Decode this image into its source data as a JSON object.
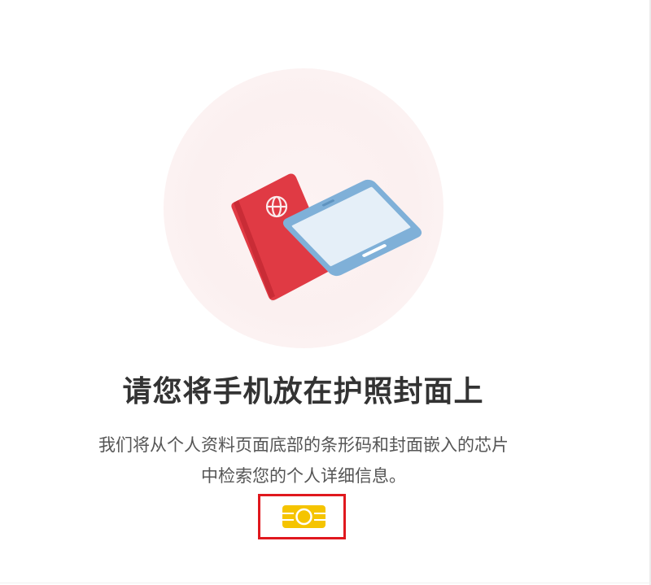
{
  "illustration": {
    "icon": "phone-on-passport-icon",
    "colors": {
      "background_circle": "#fbf0f0",
      "passport": "#e03a44",
      "phone_frame": "#7fb0d8",
      "phone_screen": "#d7e7f5"
    }
  },
  "instruction": {
    "title": "请您将手机放在护照封面上",
    "description_line1": "我们将从个人资料页面底部的条形码和封面嵌入的芯片",
    "description_line2": "中检索您的个人详细信息。"
  },
  "chip": {
    "icon": "chip-icon",
    "color": "#f5c400",
    "highlight_color": "#e0181e"
  }
}
